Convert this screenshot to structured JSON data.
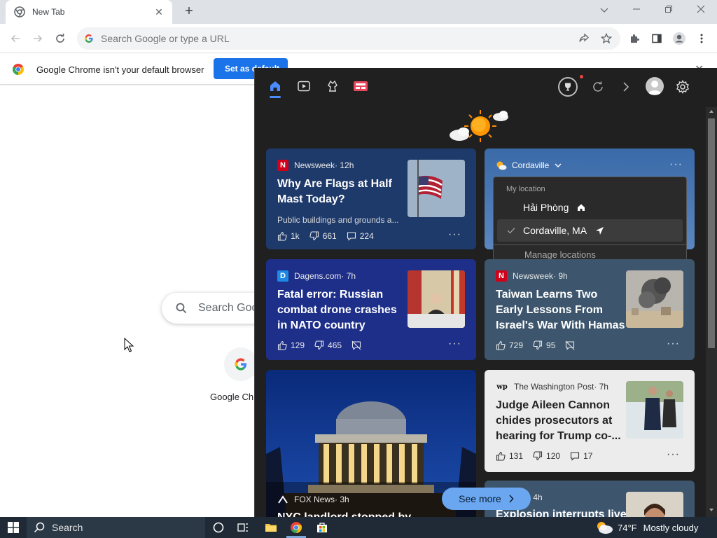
{
  "browser": {
    "tab_title": "New Tab",
    "omnibox_placeholder": "Search Google or type a URL",
    "infobar_message": "Google Chrome isn't your default browser",
    "infobar_button": "Set as default",
    "ntp_search_text": "Search Goo",
    "ntp_shortcut_label": "Google Chr"
  },
  "widgets": {
    "tabs": [
      "home-icon",
      "video-icon",
      "game-icon",
      "news-icon"
    ],
    "weather": {
      "location": "Cordaville",
      "dropdown_header": "My location",
      "options": [
        "Hải Phòng",
        "Cordaville, MA"
      ],
      "selected": "Cordaville, MA",
      "footer": "Manage locations"
    },
    "cards": [
      {
        "source": "Newsweek",
        "age": " · 12h",
        "badge": "N",
        "badge_color": "#d0021b",
        "headline": "Why Are Flags at Half Mast Today?",
        "snippet": "Public buildings and grounds a...",
        "likes": "1k",
        "dislikes": "661",
        "comments": "224"
      },
      {
        "source": "Dagens.com",
        "age": " · 7h",
        "badge": "D",
        "badge_color": "#1e88e5",
        "headline": "Fatal error: Russian combat drone crashes in NATO country",
        "likes": "129",
        "dislikes": "465"
      },
      {
        "source": "Newsweek",
        "age": " · 9h",
        "badge": "N",
        "badge_color": "#d0021b",
        "headline": "Taiwan Learns Two Early Lessons From Israel's War With Hamas",
        "likes": "729",
        "dislikes": "95"
      },
      {
        "source": "The Washington Post",
        "age": " · 7h",
        "badge": "wp",
        "headline": "Judge Aileen Cannon chides prosecutors at hearing for Trump co-...",
        "likes": "131",
        "dislikes": "120",
        "comments": "17"
      },
      {
        "source": "FOX News",
        "age": " · 3h",
        "headline": "NYC landlord stopped by"
      },
      {
        "age": " · 4h",
        "headline": "Explosion interrupts live"
      }
    ],
    "see_more": "See more"
  },
  "taskbar": {
    "search_label": "Search",
    "temperature": "74°F",
    "condition": "Mostly cloudy"
  },
  "colors": {
    "accent": "#1a73e8",
    "panel_bg": "#202020",
    "taskbar_bg": "#1f2a36"
  }
}
